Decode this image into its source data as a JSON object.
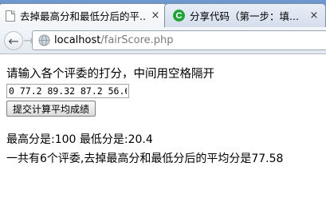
{
  "browser": {
    "tabs": [
      {
        "title": "去掉最高分和最低分后的平...",
        "close": "×",
        "active": true
      },
      {
        "title": "分享代码（第一步：填...",
        "close": "×",
        "active": false,
        "favicon_letter": "C",
        "favicon_color": "#22a33a"
      }
    ],
    "url": {
      "host": "localhost",
      "path": "/fairScore.php"
    }
  },
  "page": {
    "prompt": "请输入各个评委的打分，中间用空格隔开",
    "input_value": "0 77.2 89.32 87.2 56.6",
    "submit_label": "提交计算平均成绩",
    "max_min_line": "最高分是:100 最低分是:20.4",
    "average_line": "一共有6个评委,去掉最高分和最低分后的平均分是77.58"
  }
}
